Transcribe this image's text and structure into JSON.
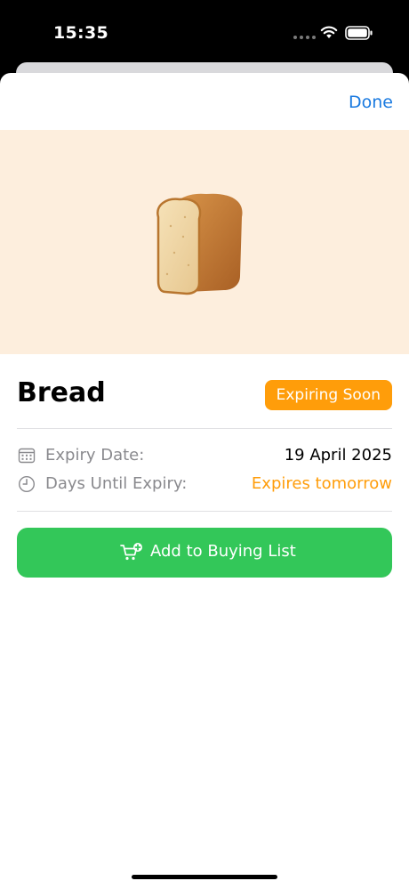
{
  "status_bar": {
    "time": "15:35",
    "icons": [
      "signal-dots-icon",
      "wifi-icon",
      "battery-icon"
    ]
  },
  "sheet": {
    "done_label": "Done",
    "hero": {
      "background_color": "#fdeedd",
      "image_icon": "bread-icon"
    },
    "item": {
      "title": "Bread",
      "badge": "Expiring Soon",
      "badge_color": "#ff9d0a"
    },
    "details": [
      {
        "icon": "calendar-icon",
        "label": "Expiry Date:",
        "value": "19 April 2025"
      },
      {
        "icon": "clock-icon",
        "label": "Days Until Expiry:",
        "value": "Expires tomorrow",
        "value_color": "#ff9d0a"
      }
    ],
    "action": {
      "icon": "cart-add-icon",
      "label": "Add to Buying List",
      "color": "#33c759"
    }
  },
  "colors": {
    "accent": "#1a7ae0",
    "warning": "#ff9d0a",
    "success": "#33c759"
  }
}
